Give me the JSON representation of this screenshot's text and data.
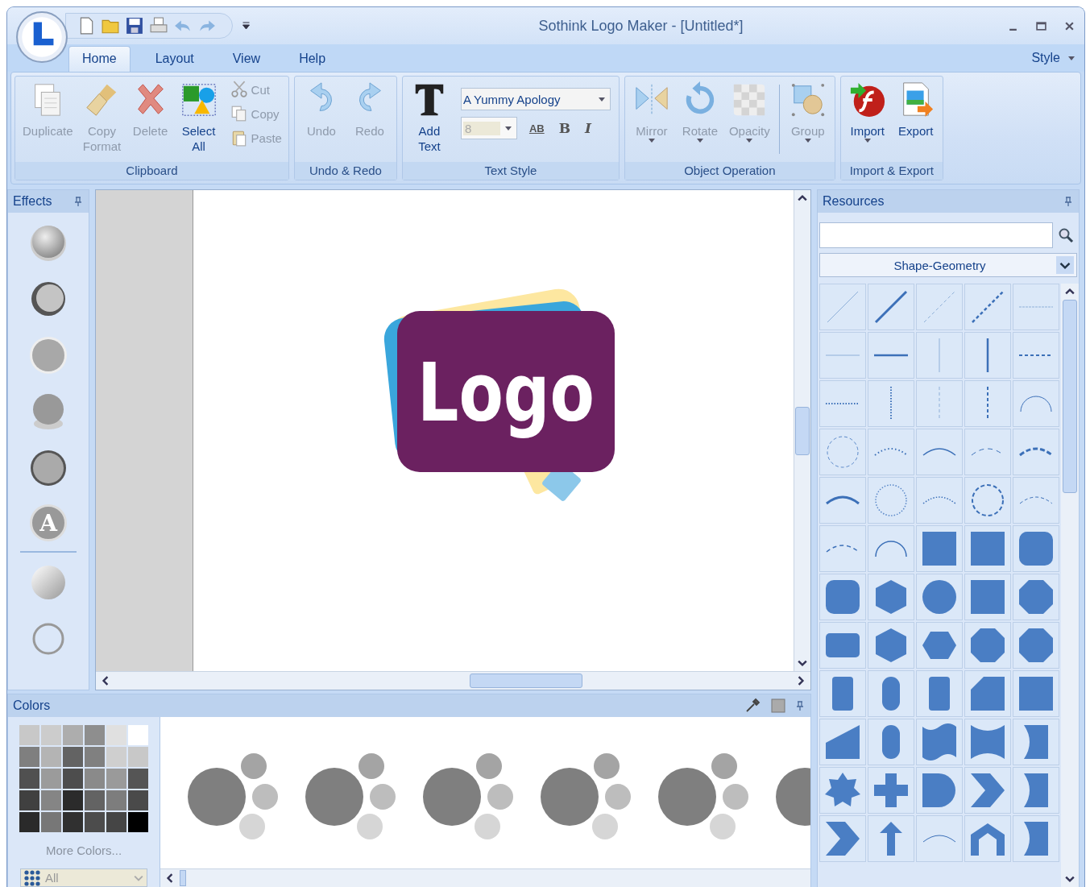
{
  "window": {
    "title": "Sothink Logo Maker - [Untitled*]"
  },
  "tabs": [
    {
      "label": "Home",
      "selected": true
    },
    {
      "label": "Layout",
      "selected": false
    },
    {
      "label": "View",
      "selected": false
    },
    {
      "label": "Help",
      "selected": false
    }
  ],
  "style_menu": {
    "label": "Style"
  },
  "ribbon": [
    {
      "title": "Clipboard",
      "items": [
        {
          "kind": "large",
          "label": "Duplicate",
          "disabled": true,
          "menu": false
        },
        {
          "kind": "large",
          "label": "Copy Format",
          "disabled": true,
          "menu": false
        },
        {
          "kind": "large",
          "label": "Delete",
          "disabled": true,
          "menu": false
        },
        {
          "kind": "large",
          "label": "Select All",
          "disabled": false,
          "menu": false
        },
        {
          "kind": "stack",
          "items": [
            {
              "label": "Cut",
              "disabled": true
            },
            {
              "label": "Copy",
              "disabled": true
            },
            {
              "label": "Paste",
              "disabled": true
            }
          ]
        }
      ]
    },
    {
      "title": "Undo & Redo",
      "items": [
        {
          "kind": "large",
          "label": "Undo",
          "disabled": true,
          "menu": false
        },
        {
          "kind": "large",
          "label": "Redo",
          "disabled": true,
          "menu": false
        }
      ]
    },
    {
      "title": "Text Style",
      "items": [
        {
          "kind": "large",
          "label": "Add Text",
          "disabled": false,
          "menu": false
        },
        {
          "kind": "font",
          "value": "A Yummy Apology",
          "size": "8",
          "size_disabled": true,
          "format": [
            {
              "kind": "spacing",
              "label": "AB"
            },
            {
              "kind": "bold",
              "label": "B"
            },
            {
              "kind": "italic",
              "label": "I"
            }
          ]
        }
      ]
    },
    {
      "title": "Object Operation",
      "items": [
        {
          "kind": "large",
          "label": "Mirror",
          "disabled": true,
          "menu": true
        },
        {
          "kind": "large",
          "label": "Rotate",
          "disabled": true,
          "menu": true
        },
        {
          "kind": "large",
          "label": "Opacity",
          "disabled": true,
          "menu": true
        },
        {
          "kind": "separator"
        },
        {
          "kind": "large",
          "label": "Group",
          "disabled": true,
          "menu": true
        }
      ]
    },
    {
      "title": "Import & Export",
      "items": [
        {
          "kind": "large",
          "label": "Import",
          "disabled": false,
          "menu": true
        },
        {
          "kind": "large",
          "label": "Export",
          "disabled": false,
          "menu": false
        }
      ]
    }
  ],
  "effects": {
    "title": "Effects",
    "items": [
      {
        "kind": "sphere"
      },
      {
        "kind": "bevel"
      },
      {
        "kind": "flat"
      },
      {
        "kind": "shadow"
      },
      {
        "kind": "outline"
      },
      {
        "kind": "letter",
        "label": "A"
      },
      {
        "kind": "divider"
      },
      {
        "kind": "gloss"
      },
      {
        "kind": "hollow"
      }
    ]
  },
  "canvas": {
    "logo_text": "Logo"
  },
  "resources": {
    "title": "Resources",
    "category": "Shape-Geometry"
  },
  "colors": {
    "title": "Colors",
    "swatches": [
      {
        "color": "#c8c8c8"
      },
      {
        "color": "#cccccc"
      },
      {
        "color": "#adadad"
      },
      {
        "color": "#8e8e8e"
      },
      {
        "color": "#e0e0e0"
      },
      {
        "color": "#ffffff"
      },
      {
        "color": "#7f7f7f"
      },
      {
        "color": "#b4b4b4"
      },
      {
        "color": "#636363"
      },
      {
        "color": "#808080"
      },
      {
        "color": "#cfcfcf"
      },
      {
        "color": "#c8c8c8"
      },
      {
        "color": "#505050"
      },
      {
        "color": "#9b9b9b"
      },
      {
        "color": "#4d4d4d"
      },
      {
        "color": "#8a8a8a"
      },
      {
        "color": "#9a9a9a"
      },
      {
        "color": "#555555"
      },
      {
        "color": "#404040"
      },
      {
        "color": "#858585"
      },
      {
        "color": "#2b2b2b"
      },
      {
        "color": "#636363"
      },
      {
        "color": "#7d7d7d"
      },
      {
        "color": "#4a4a4a"
      },
      {
        "color": "#2a2a2a"
      },
      {
        "color": "#777777"
      },
      {
        "color": "#303030"
      },
      {
        "color": "#4c4c4c"
      },
      {
        "color": "#454545"
      },
      {
        "color": "#000000"
      }
    ],
    "more_link": "More Colors...",
    "filter": "All"
  }
}
